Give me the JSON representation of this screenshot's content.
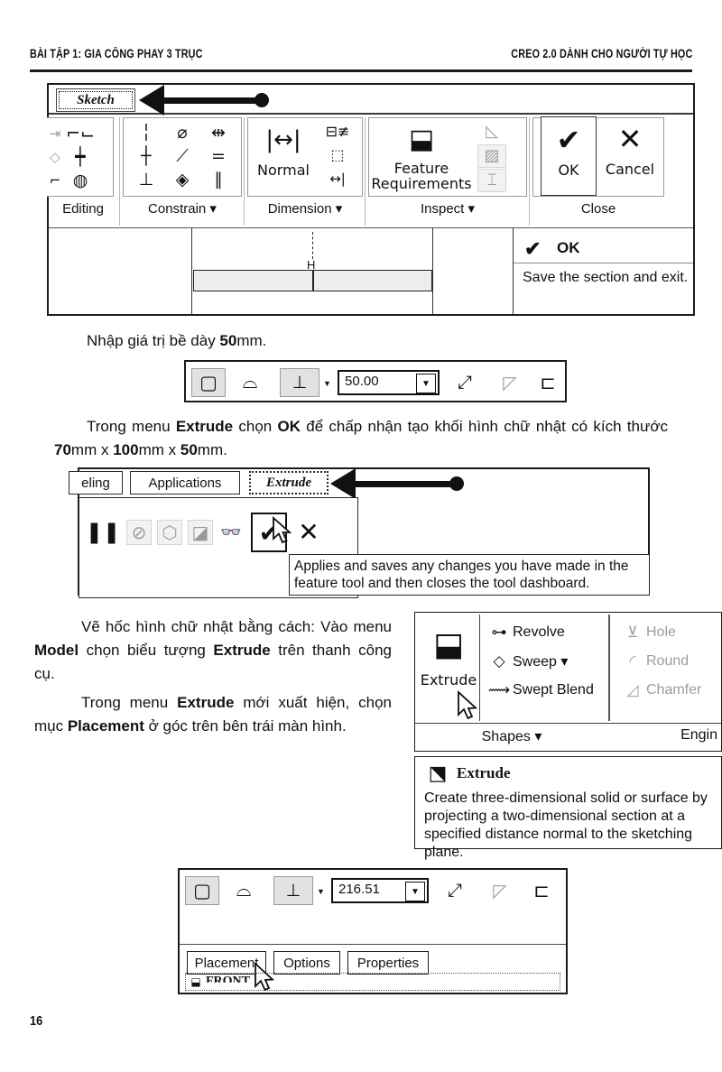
{
  "header": {
    "left": "BÀI TẬP 1: GIA CÔNG PHAY 3 TRỤC",
    "right": "CREO 2.0 DÀNH CHO NGƯỜI TỰ HỌC"
  },
  "page_number": "16",
  "sketch_ribbon": {
    "tab_label": "Sketch",
    "groups": [
      {
        "label": "Editing"
      },
      {
        "label": "Constrain ▾"
      },
      {
        "label": "Dimension ▾"
      },
      {
        "label": "Inspect ▾"
      },
      {
        "label": "Close"
      }
    ],
    "dimension_normal_label": "Normal",
    "inspect_label_1": "Feature",
    "inspect_label_2": "Requirements",
    "ok_label": "OK",
    "cancel_label": "Cancel",
    "graphics_note": "H",
    "tooltip": {
      "title": "OK",
      "body": "Save the section and exit."
    }
  },
  "para_thickness": {
    "prefix": "Nhập giá trị bề dày ",
    "bold": "50",
    "suffix": "mm."
  },
  "depth_dashboard": {
    "value": "50.00"
  },
  "para_extrude": {
    "line1_a": "Trong menu ",
    "line1_b": "Extrude",
    "line1_c": " chọn ",
    "line1_d": "OK",
    "line1_e": " để chấp nhận tạo khối hình chữ nhật có",
    "line2_a": "kích thước ",
    "line2_b": "70",
    "line2_c": "mm x ",
    "line2_d": "100",
    "line2_e": "mm x ",
    "line2_f": "50",
    "line2_g": "mm."
  },
  "extrude_dashboard": {
    "tabs": [
      {
        "label": "eling",
        "active": false
      },
      {
        "label": "Applications",
        "active": false
      },
      {
        "label": "Extrude",
        "active": true
      }
    ],
    "tooltip": {
      "line1": "Applies and saves any changes you have made in the",
      "line2": "feature tool and then closes the tool dashboard."
    }
  },
  "para_pocket": {
    "line1": "Vẽ hốc hình chữ nhật bằng",
    "line2_a": "cách: Vào menu ",
    "line2_b": "Model",
    "line2_c": " chọn biểu",
    "line3_a": "tượng ",
    "line3_b": "Extrude",
    "line3_c": " trên thanh công cụ."
  },
  "para_placement": {
    "line1_a": "Trong menu ",
    "line1_b": "Extrude",
    "line1_c": " mới",
    "line2_a": "xuất hiện, chọn mục ",
    "line2_b": "Placement",
    "line2_c": " ở",
    "line3": "góc trên bên trái màn hình."
  },
  "shapes_gallery": {
    "big_button_label": "Extrude",
    "items": [
      {
        "label": "Revolve",
        "icon": "revolve-icon",
        "disabled": false
      },
      {
        "label": "Sweep  ▾",
        "icon": "sweep-icon",
        "disabled": false
      },
      {
        "label": "Swept Blend",
        "icon": "swept-blend-icon",
        "disabled": false
      }
    ],
    "engineering_items": [
      {
        "label": "Hole",
        "icon": "hole-icon",
        "disabled": true
      },
      {
        "label": "Round",
        "icon": "round-icon",
        "disabled": true
      },
      {
        "label": "Chamfer",
        "icon": "chamfer-icon",
        "disabled": true
      }
    ],
    "footer_left": "Shapes ▾",
    "footer_right": "Engin"
  },
  "extrude_tooltip": {
    "title": "Extrude",
    "line1": "Create three-dimensional solid or surface by",
    "line2": "projecting a two-dimensional section at a",
    "line3": "specified distance normal to the sketching",
    "line4": "plane."
  },
  "placement_dashboard": {
    "value": "216.51",
    "tabs": [
      {
        "label": "Placement"
      },
      {
        "label": "Options"
      },
      {
        "label": "Properties"
      }
    ],
    "model_tree_item": "FRONT"
  }
}
